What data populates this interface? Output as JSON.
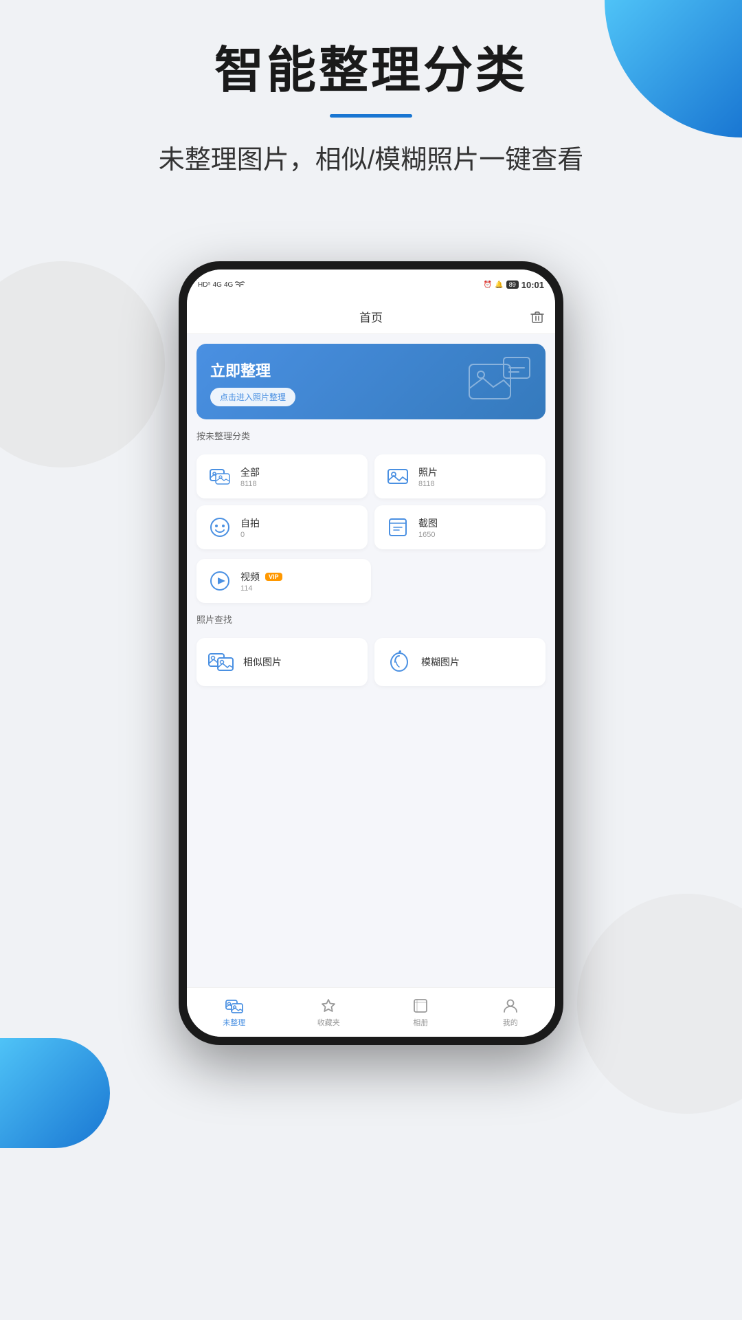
{
  "page": {
    "bg_blob_top": true,
    "bg_blob_bottom": true
  },
  "header": {
    "main_title": "智能整理分类",
    "sub_title": "未整理图片，相似/模糊照片一键查看"
  },
  "status_bar": {
    "left": "HD⁵ ⁴ᵍ ⁴ᵍ 🛜",
    "battery_text": "89",
    "time": "10:01",
    "signal_text": "HD⁵ 4G 4G WiFi"
  },
  "app_header": {
    "title": "首页",
    "trash_icon": "🗑"
  },
  "banner": {
    "title": "立即整理",
    "button_label": "点击进入照片整理"
  },
  "section1": {
    "label": "按未整理分类",
    "items": [
      {
        "name": "全部",
        "count": "8118",
        "vip": false
      },
      {
        "name": "照片",
        "count": "8118",
        "vip": false
      },
      {
        "name": "自拍",
        "count": "0",
        "vip": false
      },
      {
        "name": "截图",
        "count": "1650",
        "vip": false
      }
    ],
    "item_video": {
      "name": "视频",
      "count": "114",
      "vip": true,
      "vip_label": "VIP"
    }
  },
  "section2": {
    "label": "照片查找",
    "items": [
      {
        "name": "相似图片"
      },
      {
        "name": "模糊图片"
      }
    ]
  },
  "bottom_nav": {
    "items": [
      {
        "label": "未整理",
        "active": true
      },
      {
        "label": "收藏夹",
        "active": false
      },
      {
        "label": "相册",
        "active": false
      },
      {
        "label": "我的",
        "active": false
      }
    ]
  }
}
